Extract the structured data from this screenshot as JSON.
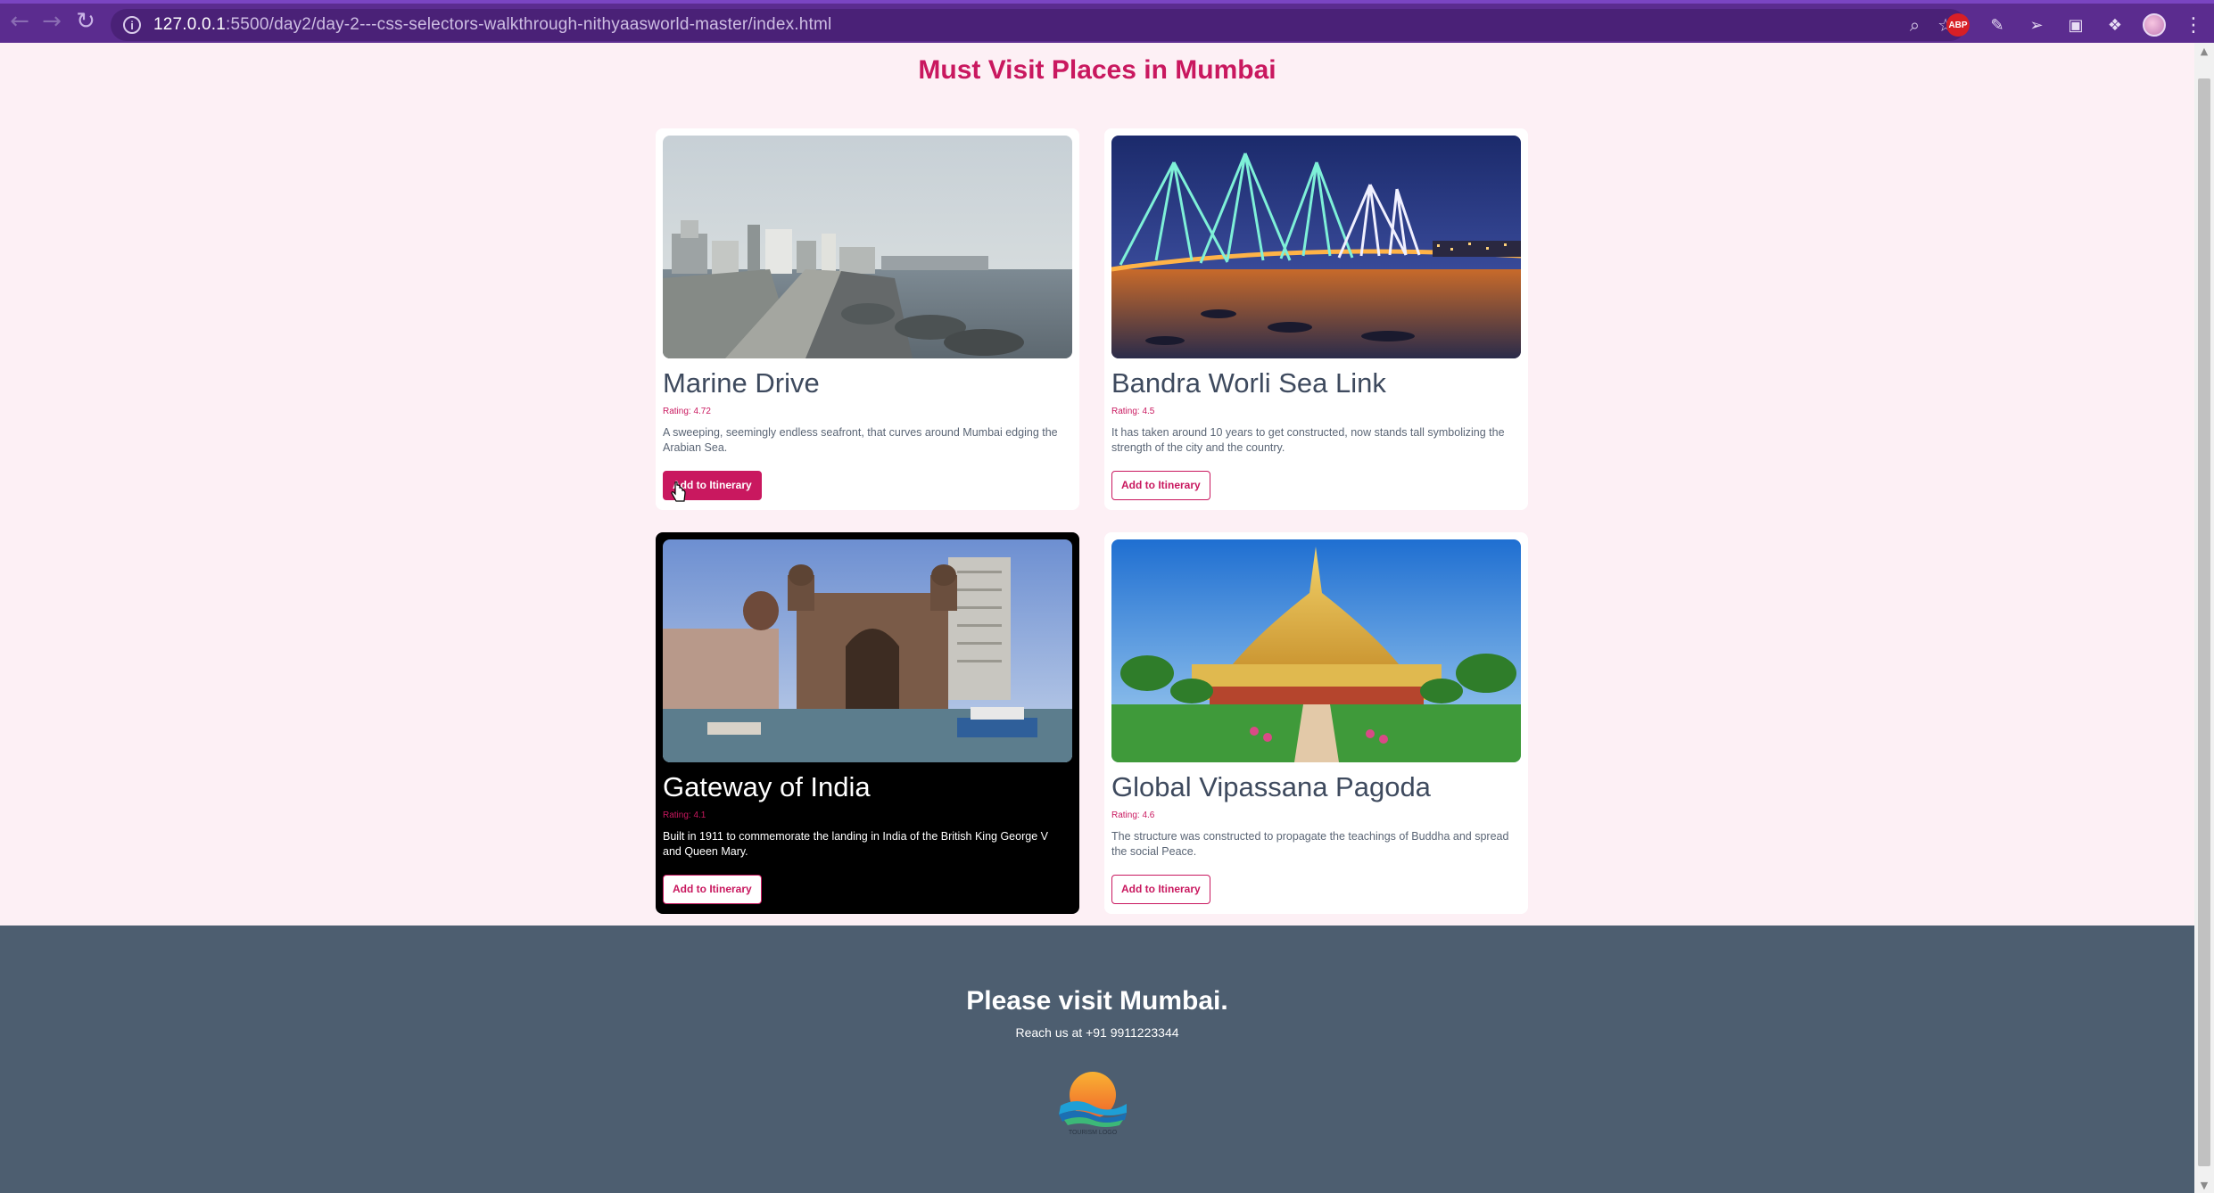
{
  "browser": {
    "url_host": "127.0.0.1",
    "url_path": ":5500/day2/day-2---css-selectors-walkthrough-nithyaasworld-master/index.html",
    "abp_label": "ABP"
  },
  "page": {
    "title": "Must Visit Places in Mumbai"
  },
  "cards": [
    {
      "title": "Marine Drive",
      "rating": "Rating: 4.72",
      "description": "A sweeping, seemingly endless seafront, that curves around Mumbai edging the Arabian Sea.",
      "button": "Add to Itinerary"
    },
    {
      "title": "Bandra Worli Sea Link",
      "rating": "Rating: 4.5",
      "description": "It has taken around 10 years to get constructed, now stands tall symbolizing the strength of the city and the country.",
      "button": "Add to Itinerary"
    },
    {
      "title": "Gateway of India",
      "rating": "Rating: 4.1",
      "description": "Built in 1911 to commemorate the landing in India of the British King George V and Queen Mary.",
      "button": "Add to Itinerary"
    },
    {
      "title": "Global Vipassana Pagoda",
      "rating": "Rating: 4.6",
      "description": "The structure was constructed to propagate the teachings of Buddha and spread the social Peace.",
      "button": "Add to Itinerary"
    }
  ],
  "footer": {
    "heading": "Please visit Mumbai.",
    "contact": "Reach us at +91 9911223344",
    "logo_text": "TOURISM LOGO"
  },
  "colors": {
    "accent": "#c9185f",
    "chrome": "#5b2c8f",
    "footer": "#4d5e70",
    "page_bg": "#fdf0f5"
  }
}
